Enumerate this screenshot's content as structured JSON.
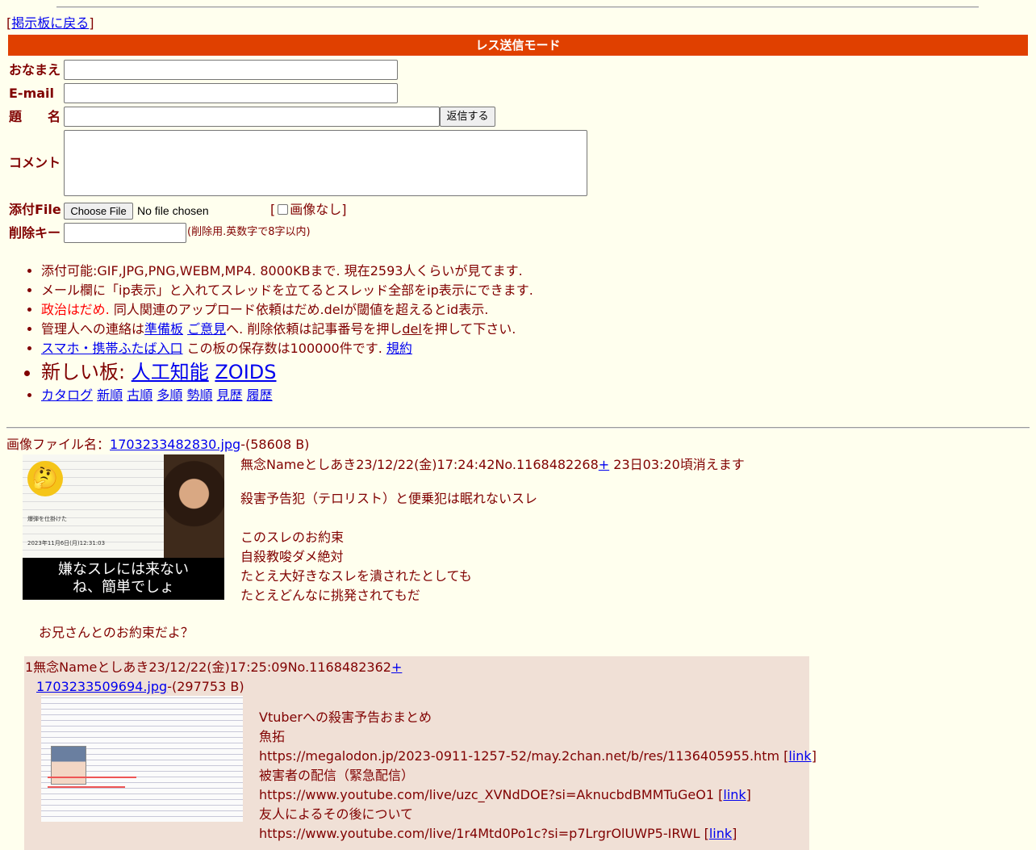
{
  "nav": {
    "back_link": "掲示板に戻る"
  },
  "form": {
    "mode_title": "レス送信モード",
    "name_label": "おなまえ",
    "email_label": "E-mail",
    "subject_label": "題　　名",
    "submit_label": "返信する",
    "comment_label": "コメント",
    "file_label": "添付File",
    "file_button": "Choose File",
    "file_status": "No file chosen",
    "noimage_label": "画像なし",
    "delkey_label": "削除キー",
    "delkey_hint": "(削除用.英数字で8字以内)"
  },
  "rules": {
    "line1": "添付可能:GIF,JPG,PNG,WEBM,MP4. 8000KBまで. 現在2593人くらいが見てます.",
    "line2": "メール欄に「ip表示」と入れてスレッドを立てるとスレッド全部をip表示にできます.",
    "line3_red": "政治はだめ.",
    "line3_rest": " 同人関連のアップロード依頼はだめ.delが閾値を超えるとid表示.",
    "line4_a": "管理人への連絡は",
    "line4_link1": "準備板",
    "line4_link2": "ご意見",
    "line4_b": "へ. 削除依頼は記事番号を押し",
    "line4_del": "del",
    "line4_c": "を押して下さい.",
    "line5_link": "スマホ・携帯ふたば入口",
    "line5_text": " この板の保存数は100000件です. ",
    "line5_terms": "規約",
    "newboards_label": "新しい板: ",
    "newboard1": "人工知能",
    "newboard2": "ZOIDS",
    "sort_links": [
      "カタログ",
      "新順",
      "古順",
      "多順",
      "勢順",
      "見歴",
      "履歴"
    ]
  },
  "thread": {
    "file_prefix": "画像ファイル名：",
    "file_name": "1703233482830.jpg",
    "file_size": "-(58608 B)",
    "thumb_caption_1": "嫌なスレには来ない",
    "thumb_caption_2": "ね、簡単でしょ",
    "thumb_text_1": "爆弾を仕掛けた",
    "thumb_text_2": "2023年11月6日(月)12:31:03",
    "header": "無念Nameとしあき23/12/22(金)17:24:42No.1168482268",
    "plus": "+",
    "expire": " 23日03:20頃消えます",
    "body": [
      "殺害予告犯（テロリスト）と便乗犯は眠れないスレ",
      "",
      "このスレのお約束",
      "自殺教唆ダメ絶対",
      "たとえ大好きなスレを潰されたとしても",
      "たとえどんなに挑発されてもだ"
    ],
    "closing": "お兄さんとのお約束だよ？"
  },
  "reply": {
    "header": "1無念Nameとしあき23/12/22(金)17:25:09No.1168482362",
    "plus": "+",
    "file_name": "1703233509694.jpg",
    "file_size": "-(297753 B)",
    "line1": "Vtuberへの殺害予告おまとめ",
    "line2": "魚拓",
    "line3": "https://megalodon.jp/2023-0911-1257-52/may.2chan.net/b/res/1136405955.htm",
    "line4": "被害者の配信（緊急配信）",
    "line5": "https://www.youtube.com/live/uzc_XVNdDOE?si=AknucbdBMMTuGeO1",
    "line6": "友人によるその後について",
    "line7": "https://www.youtube.com/live/1r4Mtd0Po1c?si=p7LrgrOlUWP5-IRWL",
    "link_label": "link"
  }
}
